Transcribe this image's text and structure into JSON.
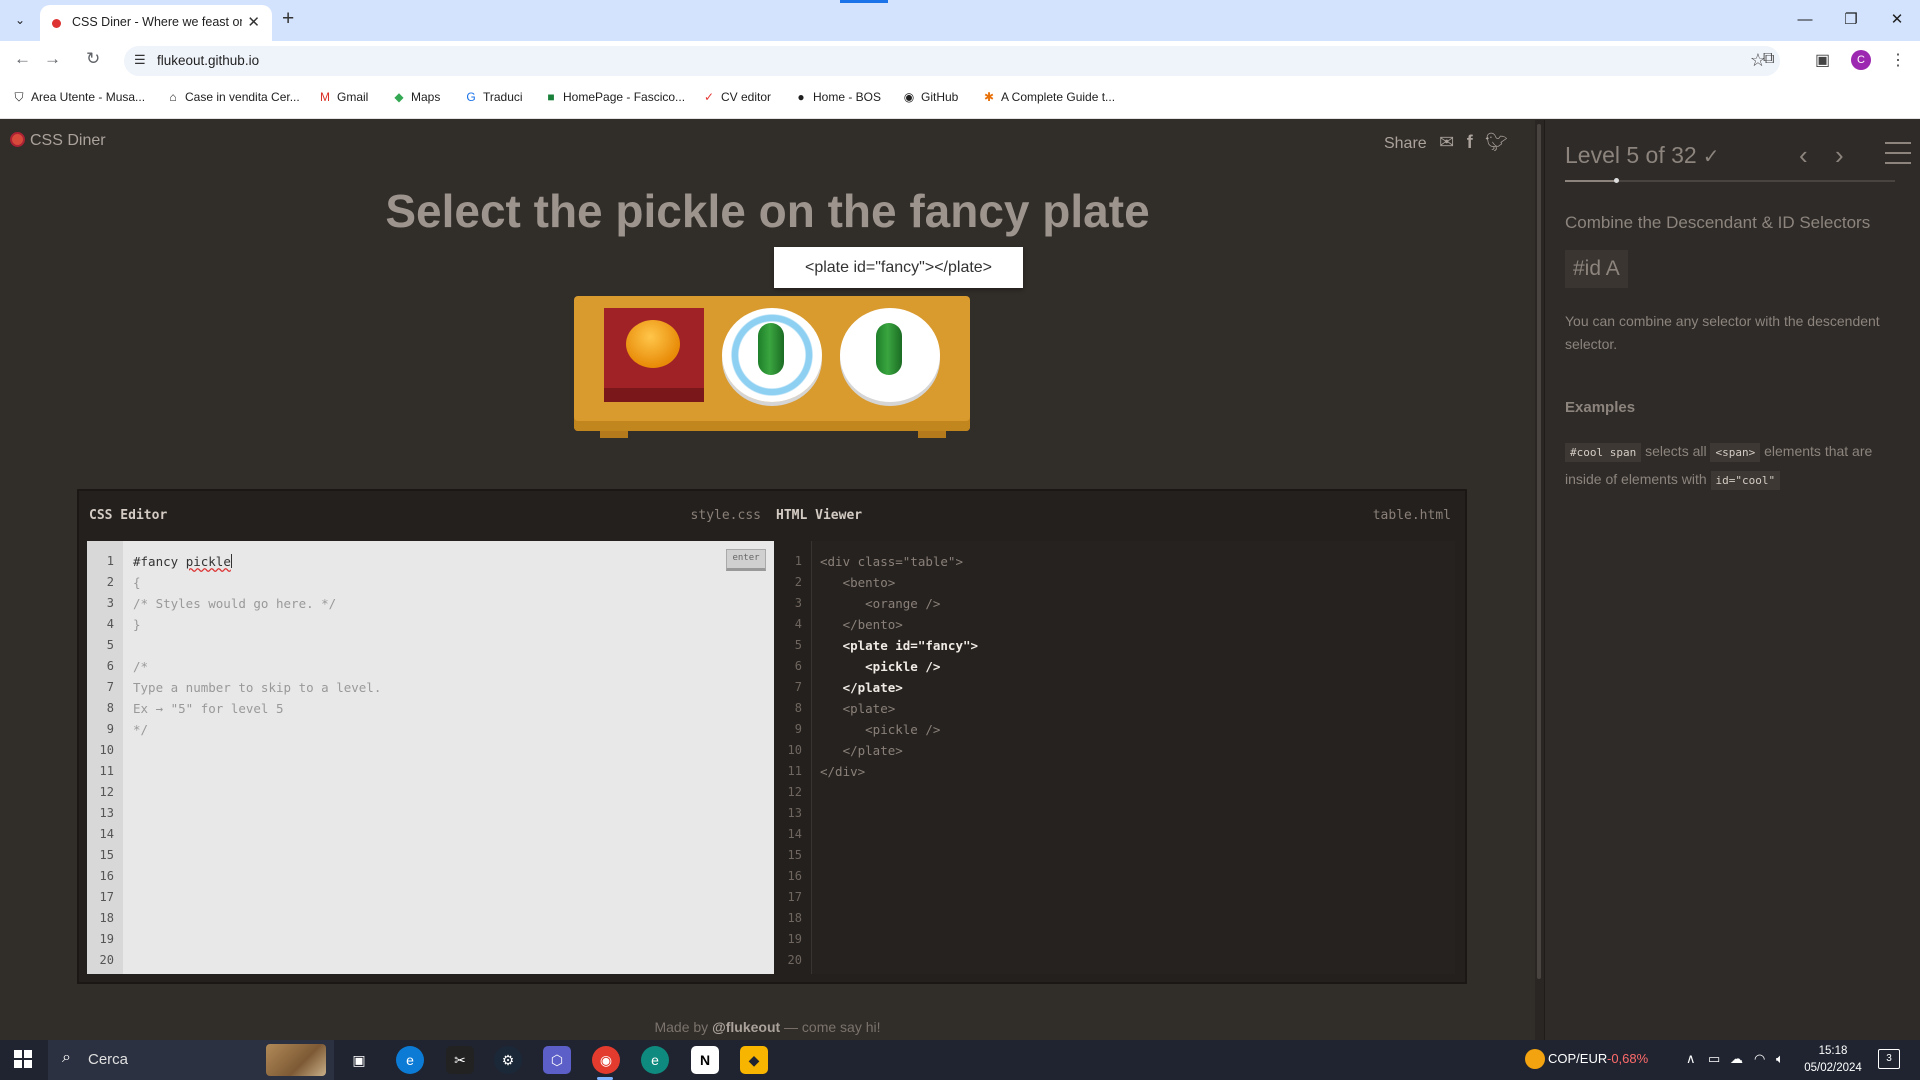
{
  "browser": {
    "tab_title": "CSS Diner - Where we feast on",
    "url": "flukeout.github.io",
    "bookmarks": [
      {
        "label": "Area Utente - Musa...",
        "icon": "shield-icon"
      },
      {
        "label": "Case in vendita Cer...",
        "icon": "house-icon"
      },
      {
        "label": "Gmail",
        "icon": "gmail-icon"
      },
      {
        "label": "Maps",
        "icon": "maps-icon"
      },
      {
        "label": "Traduci",
        "icon": "translate-icon"
      },
      {
        "label": "HomePage - Fascico...",
        "icon": "folder-icon"
      },
      {
        "label": "CV editor",
        "icon": "cv-icon"
      },
      {
        "label": "Home - BOS",
        "icon": "bos-icon"
      },
      {
        "label": "GitHub",
        "icon": "github-icon"
      },
      {
        "label": "A Complete Guide t...",
        "icon": "asterisk-icon"
      }
    ]
  },
  "game": {
    "logo": "CSS Diner",
    "share_label": "Share",
    "order": "Select the pickle on the fancy plate",
    "tooltip": "<plate id=\"fancy\"></plate>",
    "made_by_prefix": "Made by ",
    "made_by_author": "@flukeout",
    "made_by_suffix": " — come say hi!"
  },
  "editor": {
    "css_title": "CSS Editor",
    "css_file": "style.css",
    "html_title": "HTML Viewer",
    "html_file": "table.html",
    "enter_label": "enter",
    "css_input_a": "#fancy ",
    "css_input_b": "pickle",
    "css_lines": [
      "{",
      "/* Styles would go here. */",
      "}",
      "",
      "/*",
      "Type a number to skip to a level.",
      "Ex → \"5\" for level 5",
      "*/"
    ],
    "line_numbers": [
      "1",
      "2",
      "3",
      "4",
      "5",
      "6",
      "7",
      "8",
      "9",
      "10",
      "11",
      "12",
      "13",
      "14",
      "15",
      "16",
      "17",
      "18",
      "19",
      "20"
    ],
    "html_lines": [
      "<div class=\"table\">",
      "   <bento>",
      "      <orange />",
      "   </bento>",
      "   <plate id=\"fancy\">",
      "      <pickle />",
      "   </plate>",
      "   <plate>",
      "      <pickle />",
      "   </plate>",
      "</div>"
    ]
  },
  "sidebar": {
    "level_title": "Level 5 of 32",
    "level_progress": 0.156,
    "heading": "Combine the Descendant & ID Selectors",
    "syntax": "#id  A",
    "description": "You can combine any selector with the descendent selector.",
    "examples_title": "Examples",
    "example_code": "#cool span",
    "example_text_1": " selects all ",
    "example_code_2": "<span>",
    "example_text_2": " elements that are inside of elements with ",
    "example_code_3": "id=\"cool\""
  },
  "taskbar": {
    "search_placeholder": "Cerca",
    "ticker_name": "COP/EUR",
    "ticker_value": "-0,68%",
    "time": "15:18",
    "date": "05/02/2024",
    "notifications": "3"
  },
  "colors": {
    "accent": "#1a73e8",
    "game_bg": "#312d29",
    "table": "#d99a2e",
    "bento": "#a12226",
    "pickle": "#3aa63f",
    "fancy_rim": "#8ed0f2"
  }
}
